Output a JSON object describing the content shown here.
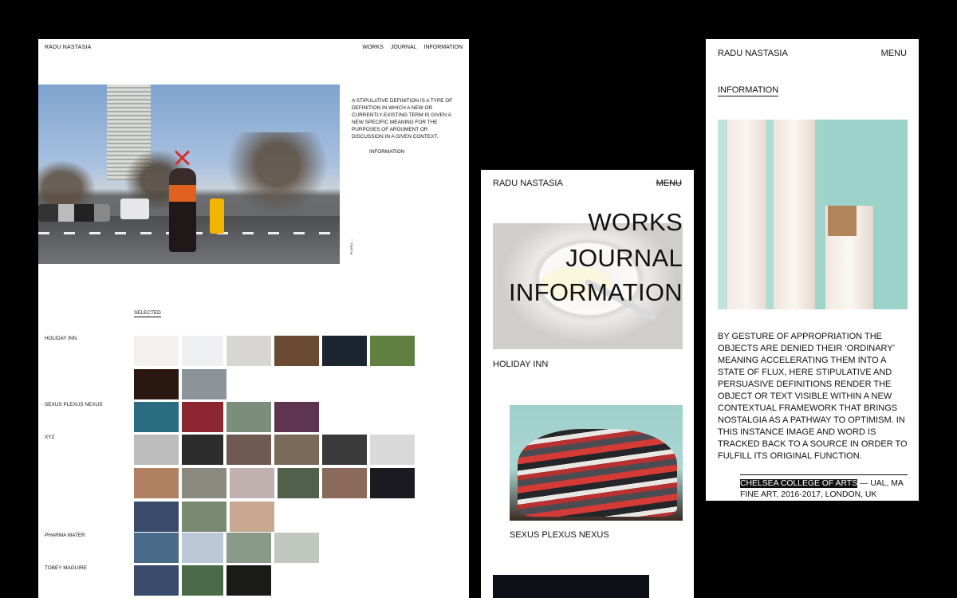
{
  "desktop": {
    "brand": "RADU NASTASIA",
    "nav": [
      "WORKS",
      "JOURNAL",
      "INFORMATION"
    ],
    "blurb": "A STIPULATIVE DEFINITION IS A TYPE OF DEFINITION IN WHICH A NEW OR CURRENTLY-EXISTING TERM IS GIVEN A NEW SPECIFIC MEANING FOR THE PURPOSES OF ARGUMENT OR DISCUSSION IN A GIVEN CONTEXT.",
    "info_link": "INFORMATION",
    "hero_caption": "PLURAL →",
    "selected_label": "SELECTED",
    "projects": [
      {
        "name": "HOLIDAY INN",
        "thumbs": [
          "#f4f1ee",
          "#eef0f1",
          "#d8d6d2",
          "#6b4a33",
          "#1c2430",
          "#5f8040",
          "#2a1810",
          "#8c9399"
        ]
      },
      {
        "name": "SEXUS PLEXUS NEXUS",
        "thumbs": [
          "#2a6d80",
          "#8c2630",
          "#7c8d7c",
          "#5e3550"
        ]
      },
      {
        "name": "XYZ",
        "thumbs": [
          "#bdbdbd",
          "#2c2c2c",
          "#6e5a50",
          "#7a6a5a",
          "#3a3a3a",
          "#d9d9d9",
          "#b08060",
          "#8a8a80",
          "#c0b0b0",
          "#50604a",
          "#8a6a5a",
          "#1a1a20",
          "#3a4a6a",
          "#7a8a70",
          "#c8a890"
        ]
      },
      {
        "name": "PHARMA MATER",
        "thumbs": [
          "#4a6a8a",
          "#bcc8d8",
          "#8a9a8a",
          "#c0c8c0"
        ]
      },
      {
        "name": "TOBEY MAGUIRE",
        "thumbs": [
          "#3a4a6a",
          "#4a6a4a",
          "#1a1a18"
        ]
      }
    ]
  },
  "menu_panel": {
    "brand": "RADU NASTASIA",
    "menu_label": "MENU",
    "links": [
      "WORKS",
      "JOURNAL",
      "INFORMATION"
    ],
    "project_1": "HOLIDAY INN",
    "project_2": "SEXUS PLEXUS NEXUS"
  },
  "info_panel": {
    "brand": "RADU NASTASIA",
    "menu_label": "MENU",
    "section_title": "INFORMATION",
    "paragraph": "BY GESTURE OF APPROPRIATION THE OBJECTS ARE DENIED THEIR ‘ORDINARY’ MEANING ACCELERATING THEM INTO A STATE OF FLUX, HERE STIPULATIVE AND PERSUASIVE DEFINITIONS RENDER THE OBJECT OR TEXT VISIBLE WITHIN A NEW CONTEXTUAL FRAMEWORK THAT BRINGS NOSTALGIA AS A PATHWAY TO OPTIMISM. IN THIS INSTANCE IMAGE AND WORD IS TRACKED BACK TO A SOURCE IN ORDER TO FULFILL ITS ORIGINAL FUNCTION.",
    "cv_school": "CHELSEA COLLEGE OF ARTS",
    "cv_detail": " — UAL, MA FINE ART, 2016-2017, LONDON, UK"
  }
}
